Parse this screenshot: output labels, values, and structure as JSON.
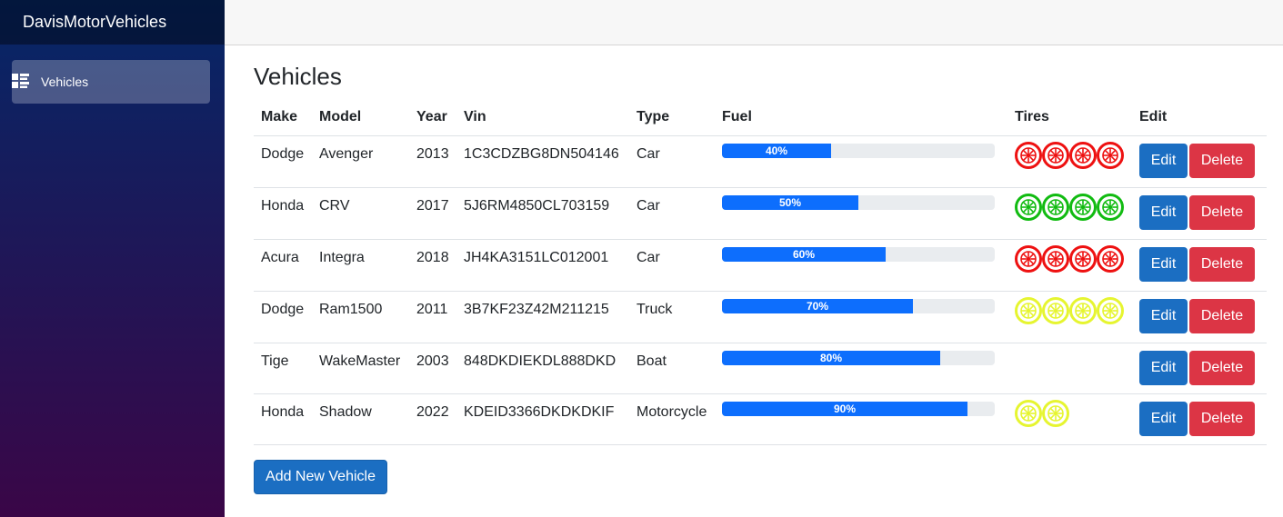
{
  "brand": "DavisMotorVehicles",
  "nav": {
    "vehicles_label": "Vehicles"
  },
  "page_title": "Vehicles",
  "table": {
    "headers": [
      "Make",
      "Model",
      "Year",
      "Vin",
      "Type",
      "Fuel",
      "Tires",
      "Edit"
    ],
    "rows": [
      {
        "make": "Dodge",
        "model": "Avenger",
        "year": "2013",
        "vin": "1C3CDZBG8DN504146",
        "type": "Car",
        "fuel": 40,
        "fuel_label": "40%",
        "tire_count": 4,
        "tire_color": "#ee1111"
      },
      {
        "make": "Honda",
        "model": "CRV",
        "year": "2017",
        "vin": "5J6RM4850CL703159",
        "type": "Car",
        "fuel": 50,
        "fuel_label": "50%",
        "tire_count": 4,
        "tire_color": "#11bb11"
      },
      {
        "make": "Acura",
        "model": "Integra",
        "year": "2018",
        "vin": "JH4KA3151LC012001",
        "type": "Car",
        "fuel": 60,
        "fuel_label": "60%",
        "tire_count": 4,
        "tire_color": "#ee1111"
      },
      {
        "make": "Dodge",
        "model": "Ram1500",
        "year": "2011",
        "vin": "3B7KF23Z42M211215",
        "type": "Truck",
        "fuel": 70,
        "fuel_label": "70%",
        "tire_count": 4,
        "tire_color": "#e6f530"
      },
      {
        "make": "Tige",
        "model": "WakeMaster",
        "year": "2003",
        "vin": "848DKDIEKDL888DKD",
        "type": "Boat",
        "fuel": 80,
        "fuel_label": "80%",
        "tire_count": 0,
        "tire_color": "#e6f530"
      },
      {
        "make": "Honda",
        "model": "Shadow",
        "year": "2022",
        "vin": "KDEID3366DKDKDKIF",
        "type": "Motorcycle",
        "fuel": 90,
        "fuel_label": "90%",
        "tire_count": 2,
        "tire_color": "#e6f530"
      }
    ],
    "edit_label": "Edit",
    "delete_label": "Delete"
  },
  "add_button_label": "Add New Vehicle",
  "colors": {
    "primary": "#1b6ec2",
    "danger": "#dc3545",
    "progress": "#0d6efd"
  }
}
